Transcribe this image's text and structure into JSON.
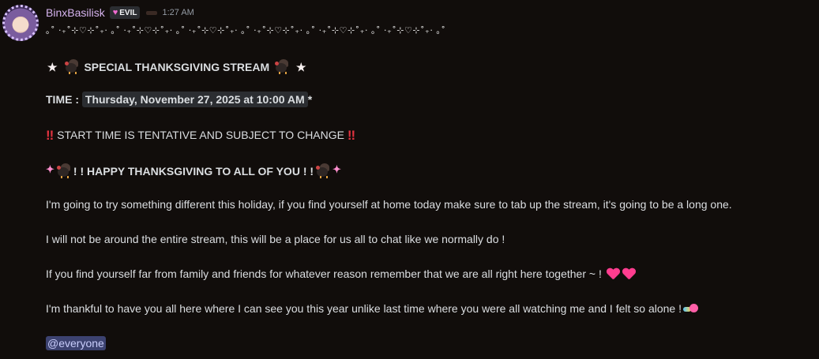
{
  "message": {
    "author": "BinxBasilisk",
    "tag_label": "EVIL",
    "timestamp": "1:27 AM",
    "divider": "｡˚ ‧₊˚⊹♡⊹˚₊‧ ｡˚ ‧₊˚⊹♡⊹˚₊‧ ｡˚ ‧₊˚⊹♡⊹˚₊‧ ｡˚ ‧₊˚⊹♡⊹˚₊‧ ｡˚ ‧₊˚⊹♡⊹˚₊‧  ｡˚ ‧₊˚⊹♡⊹˚₊‧ ｡˚",
    "stream_title": "SPECIAL THANKSGIVING STREAM",
    "time_label": "TIME :",
    "time_value": "Thursday, November 27, 2025 at 10:00 AM",
    "time_suffix": "*",
    "tentative": "START TIME IS TENTATIVE AND SUBJECT TO CHANGE",
    "happy": "! ! HAPPY THANKSGIVING TO ALL OF YOU ! !",
    "para1": "I'm going to try something different this holiday, if you find yourself at home today make sure to tab up the stream, it's going to be a long one.",
    "para2": "I will not be around the entire stream, this will be a place for us all to chat like we normally do !",
    "para3": "If you find yourself far from family and friends for whatever reason remember that we are all right here together ~ !",
    "para4": "I'm thankful to have you all here where I can see you this year unlike last time where you were all watching me and I felt so alone  !",
    "mention": "@everyone"
  },
  "icons": {
    "star": "★",
    "bang": "‼",
    "sparkle": "✦"
  },
  "colors": {
    "background": "#110d0b",
    "username": "#d5b3ee",
    "mention_bg": "#3c4270",
    "mention_text": "#c9cdfb",
    "alert": "#e0323f"
  }
}
